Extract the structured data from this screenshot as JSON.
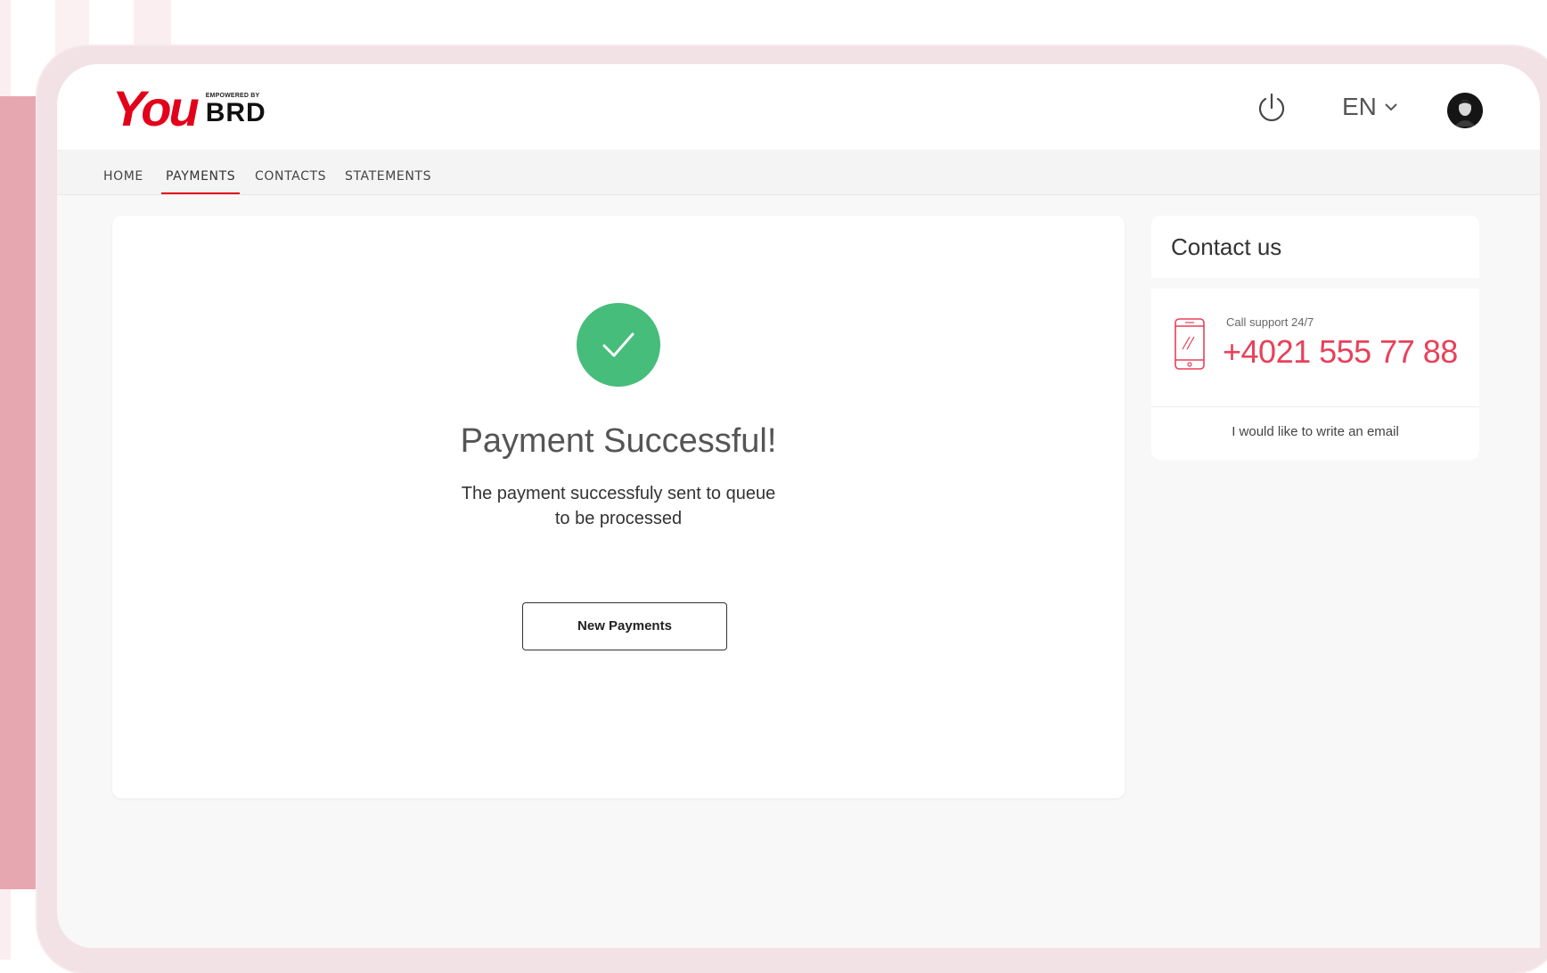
{
  "brand": {
    "logo_you": "You",
    "logo_empowered": "EMPOWERED BY",
    "logo_brd": "BRD",
    "accent_color": "#e2001a",
    "success_color": "#46bd7a"
  },
  "header": {
    "language": "EN",
    "icons": [
      "power-icon",
      "chevron-down-icon",
      "avatar"
    ]
  },
  "nav": {
    "items": [
      {
        "label": "HOME",
        "active": false
      },
      {
        "label": "PAYMENTS",
        "active": true
      },
      {
        "label": "CONTACTS",
        "active": false
      },
      {
        "label": "STATEMENTS",
        "active": false
      }
    ]
  },
  "main": {
    "title": "Payment Successful!",
    "message_line1": "The payment successfuly sent to queue",
    "message_line2": "to be processed",
    "button_label": "New Payments"
  },
  "contact": {
    "title": "Contact us",
    "support_label": "Call support 24/7",
    "phone": "+4021 555 77 88",
    "email_link": "I would like to write an email",
    "phone_color": "#e8415a"
  }
}
